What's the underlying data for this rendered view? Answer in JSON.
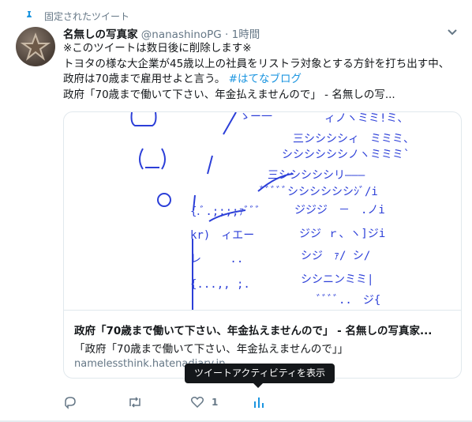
{
  "pinned": {
    "label": "固定されたツイート",
    "icon": "pin-icon"
  },
  "tweet": {
    "name": "名無しの写真家",
    "handle": "@nanashinoPG",
    "dot": "·",
    "time": "1時間",
    "lines": [
      "※このツイートは数日後に削除します※",
      "トヨタの様な大企業が45歳以上の社員をリストラ対象とする方針を打ち出す中、"
    ],
    "line3_text": "政府は70歳まで雇用せよと言う。",
    "hashtag": "#はてなブログ",
    "line4": "政府「70歳まで働いて下さい、年金払えませんので」 - 名無しの写..."
  },
  "card": {
    "title": "政府「70歳まで働いて下さい、年金払えませんので」 - 名無しの写真家...",
    "description": "「政府「70歳まで働いて下さい、年金払えませんので」」",
    "domain": "namelessthink.hatenadiary.jp"
  },
  "actions": {
    "reply_icon": "reply-icon",
    "retweet_icon": "retweet-icon",
    "like_icon": "heart-icon",
    "like_count": "1",
    "analytics_icon": "analytics-icon"
  },
  "tooltip": {
    "text": "ツイートアクティビティを表示"
  },
  "colors": {
    "accent": "#1b95e0",
    "muted": "#657786",
    "art": "#2c3fd8"
  }
}
